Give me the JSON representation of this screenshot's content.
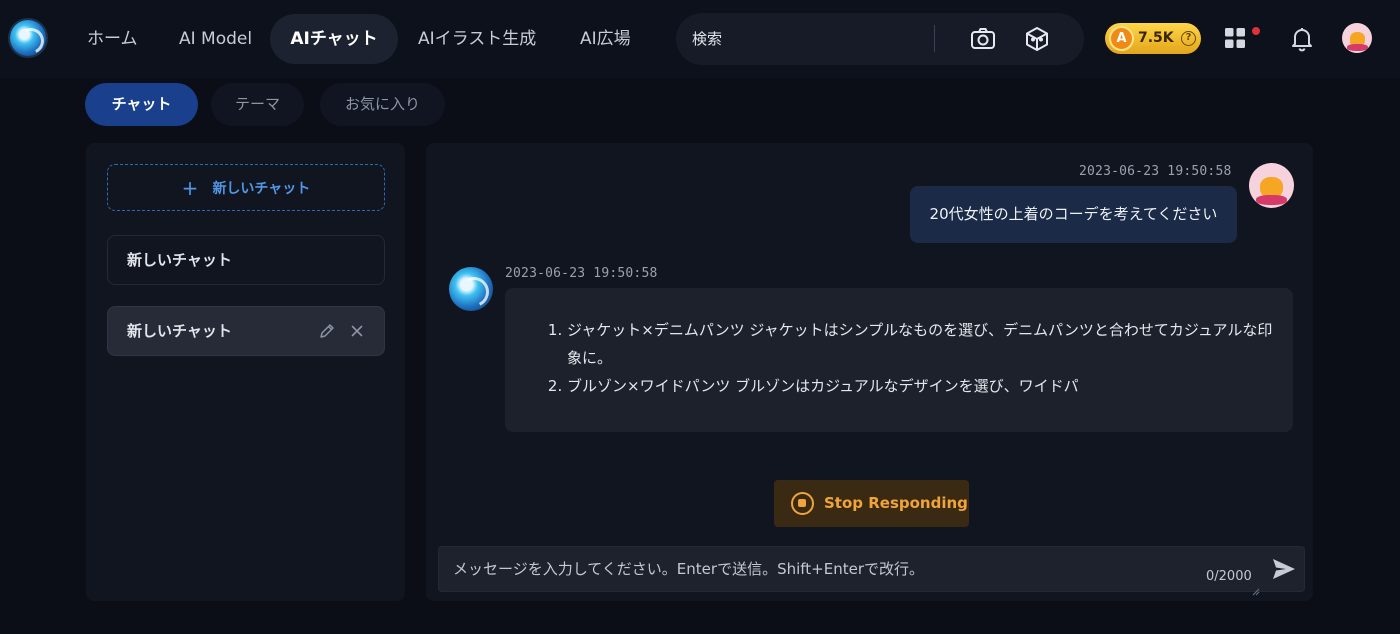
{
  "nav": {
    "items": [
      {
        "label": "ホーム"
      },
      {
        "label": "AI Model"
      },
      {
        "label": "AIチャット"
      },
      {
        "label": "AIイラスト生成"
      },
      {
        "label": "AI広場"
      }
    ],
    "search_placeholder": "検索",
    "coins": "7.5K",
    "coin_symbol": "A",
    "help_symbol": "?",
    "icons": [
      "logo-icon",
      "camera-icon",
      "cube-icon",
      "coin-icon",
      "help-icon",
      "apps-grid-icon",
      "bell-icon",
      "avatar"
    ],
    "colors": {
      "accent": "#1a3f8c",
      "coin": "#f5c033",
      "badge": "#e0303a"
    }
  },
  "tabs": [
    {
      "label": "チャット"
    },
    {
      "label": "テーマ"
    },
    {
      "label": "お気に入り"
    }
  ],
  "sidebar": {
    "new_chat_plus": "+",
    "new_chat_label": "新しいチャット",
    "chats": [
      {
        "label": "新しいチャット"
      },
      {
        "label": "新しいチャット"
      }
    ]
  },
  "chat": {
    "messages": [
      {
        "role": "user",
        "time": "2023-06-23 19:50:58",
        "text": "20代女性の上着のコーデを考えてください"
      },
      {
        "role": "assistant",
        "time": "2023-06-23 19:50:58",
        "items": [
          "ジャケット×デニムパンツ ジャケットはシンプルなものを選び、デニムパンツと合わせてカジュアルな印象に。",
          "ブルゾン×ワイドパンツ ブルゾンはカジュアルなデザインを選び、ワイドパ"
        ]
      }
    ],
    "stop_label": "Stop Responding",
    "input_placeholder": "メッセージを入力してください。Enterで送信。Shift+Enterで改行。",
    "counter": "0/2000",
    "colors": {
      "stop": "#f0a43a",
      "user_bubble": "#1b2a47"
    }
  }
}
